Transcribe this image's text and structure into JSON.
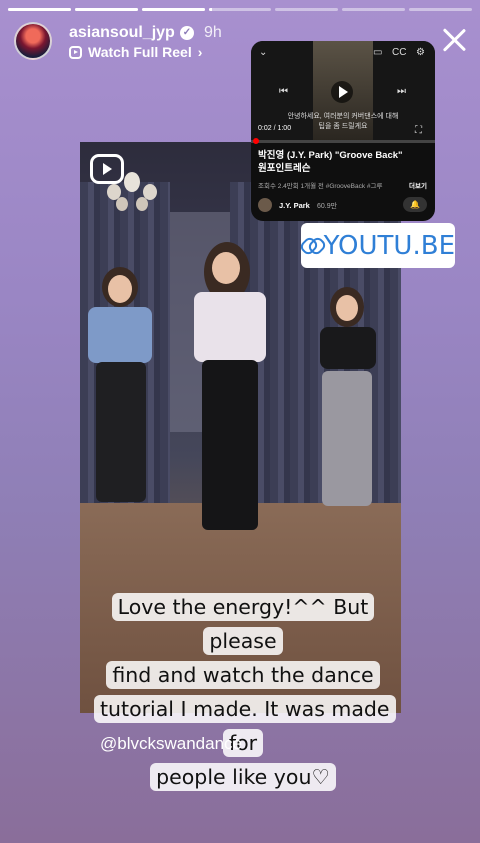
{
  "story": {
    "progress": [
      1,
      1,
      1,
      0.05,
      0,
      0,
      0
    ],
    "username": "asiansoul_jyp",
    "time_ago": "9h",
    "reel_link": "Watch Full Reel",
    "mention": "@blvckswandance",
    "caption_lines": [
      "Love the energy!^^ But please",
      "find and watch the dance",
      "tutorial I made. It was made for",
      "people like you♡"
    ]
  },
  "youtube": {
    "subtitle_line1": "안녕하세요, 여러분의 커버댄스에 대해",
    "subtitle_line2": "팁을 좀 드릴게요",
    "time": "0:02 / 1:00",
    "title_line1": "박진영 (J.Y. Park) \"Groove Back\"",
    "title_line2": "원포인트레슨",
    "meta": "조회수 2.4만회  1개월 전  #GrooveBack  #그루",
    "more": "더보기",
    "channel": "J.Y. Park",
    "subscribers": "60.9만"
  },
  "link_sticker": {
    "label": "YOUTU.BE"
  },
  "colors": {
    "background_top": "#a890cf",
    "background_bottom": "#8a6e9a",
    "link_blue": "#2f7fd6"
  }
}
